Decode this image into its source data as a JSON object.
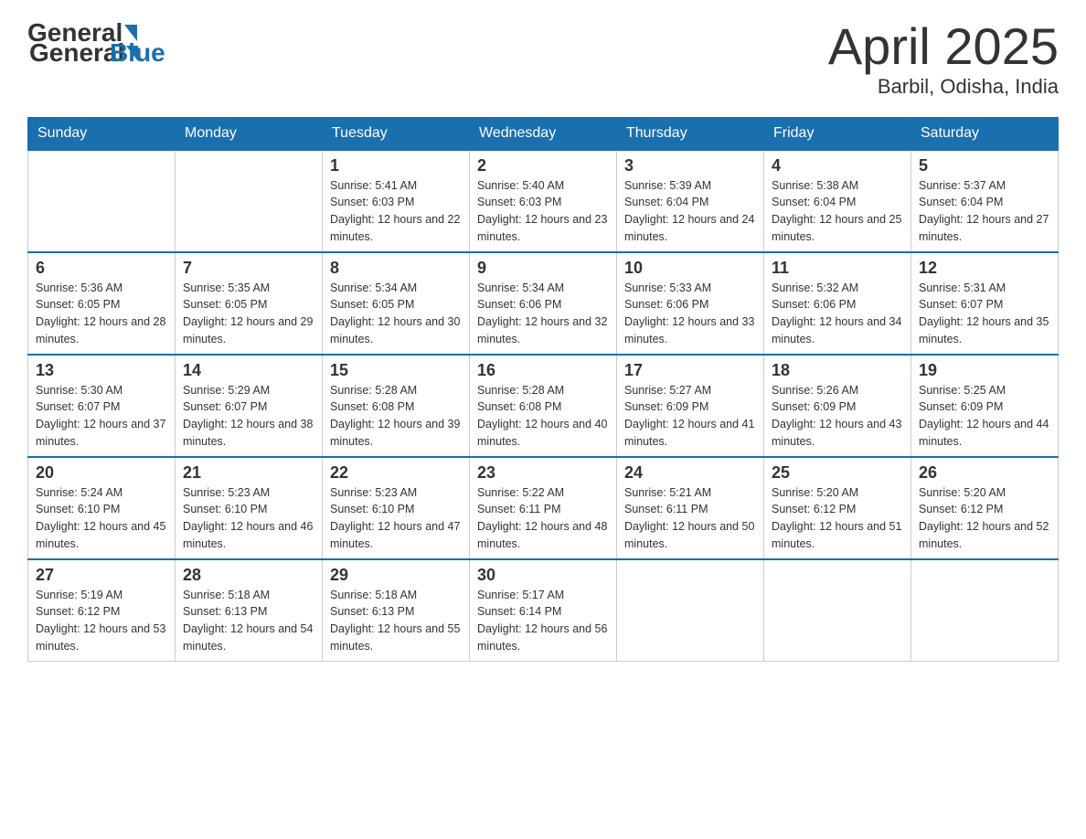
{
  "header": {
    "logo_text_general": "General",
    "logo_text_blue": "Blue",
    "month_title": "April 2025",
    "location": "Barbil, Odisha, India"
  },
  "weekdays": [
    "Sunday",
    "Monday",
    "Tuesday",
    "Wednesday",
    "Thursday",
    "Friday",
    "Saturday"
  ],
  "weeks": [
    [
      {
        "day": "",
        "sunrise": "",
        "sunset": "",
        "daylight": ""
      },
      {
        "day": "",
        "sunrise": "",
        "sunset": "",
        "daylight": ""
      },
      {
        "day": "1",
        "sunrise": "Sunrise: 5:41 AM",
        "sunset": "Sunset: 6:03 PM",
        "daylight": "Daylight: 12 hours and 22 minutes."
      },
      {
        "day": "2",
        "sunrise": "Sunrise: 5:40 AM",
        "sunset": "Sunset: 6:03 PM",
        "daylight": "Daylight: 12 hours and 23 minutes."
      },
      {
        "day": "3",
        "sunrise": "Sunrise: 5:39 AM",
        "sunset": "Sunset: 6:04 PM",
        "daylight": "Daylight: 12 hours and 24 minutes."
      },
      {
        "day": "4",
        "sunrise": "Sunrise: 5:38 AM",
        "sunset": "Sunset: 6:04 PM",
        "daylight": "Daylight: 12 hours and 25 minutes."
      },
      {
        "day": "5",
        "sunrise": "Sunrise: 5:37 AM",
        "sunset": "Sunset: 6:04 PM",
        "daylight": "Daylight: 12 hours and 27 minutes."
      }
    ],
    [
      {
        "day": "6",
        "sunrise": "Sunrise: 5:36 AM",
        "sunset": "Sunset: 6:05 PM",
        "daylight": "Daylight: 12 hours and 28 minutes."
      },
      {
        "day": "7",
        "sunrise": "Sunrise: 5:35 AM",
        "sunset": "Sunset: 6:05 PM",
        "daylight": "Daylight: 12 hours and 29 minutes."
      },
      {
        "day": "8",
        "sunrise": "Sunrise: 5:34 AM",
        "sunset": "Sunset: 6:05 PM",
        "daylight": "Daylight: 12 hours and 30 minutes."
      },
      {
        "day": "9",
        "sunrise": "Sunrise: 5:34 AM",
        "sunset": "Sunset: 6:06 PM",
        "daylight": "Daylight: 12 hours and 32 minutes."
      },
      {
        "day": "10",
        "sunrise": "Sunrise: 5:33 AM",
        "sunset": "Sunset: 6:06 PM",
        "daylight": "Daylight: 12 hours and 33 minutes."
      },
      {
        "day": "11",
        "sunrise": "Sunrise: 5:32 AM",
        "sunset": "Sunset: 6:06 PM",
        "daylight": "Daylight: 12 hours and 34 minutes."
      },
      {
        "day": "12",
        "sunrise": "Sunrise: 5:31 AM",
        "sunset": "Sunset: 6:07 PM",
        "daylight": "Daylight: 12 hours and 35 minutes."
      }
    ],
    [
      {
        "day": "13",
        "sunrise": "Sunrise: 5:30 AM",
        "sunset": "Sunset: 6:07 PM",
        "daylight": "Daylight: 12 hours and 37 minutes."
      },
      {
        "day": "14",
        "sunrise": "Sunrise: 5:29 AM",
        "sunset": "Sunset: 6:07 PM",
        "daylight": "Daylight: 12 hours and 38 minutes."
      },
      {
        "day": "15",
        "sunrise": "Sunrise: 5:28 AM",
        "sunset": "Sunset: 6:08 PM",
        "daylight": "Daylight: 12 hours and 39 minutes."
      },
      {
        "day": "16",
        "sunrise": "Sunrise: 5:28 AM",
        "sunset": "Sunset: 6:08 PM",
        "daylight": "Daylight: 12 hours and 40 minutes."
      },
      {
        "day": "17",
        "sunrise": "Sunrise: 5:27 AM",
        "sunset": "Sunset: 6:09 PM",
        "daylight": "Daylight: 12 hours and 41 minutes."
      },
      {
        "day": "18",
        "sunrise": "Sunrise: 5:26 AM",
        "sunset": "Sunset: 6:09 PM",
        "daylight": "Daylight: 12 hours and 43 minutes."
      },
      {
        "day": "19",
        "sunrise": "Sunrise: 5:25 AM",
        "sunset": "Sunset: 6:09 PM",
        "daylight": "Daylight: 12 hours and 44 minutes."
      }
    ],
    [
      {
        "day": "20",
        "sunrise": "Sunrise: 5:24 AM",
        "sunset": "Sunset: 6:10 PM",
        "daylight": "Daylight: 12 hours and 45 minutes."
      },
      {
        "day": "21",
        "sunrise": "Sunrise: 5:23 AM",
        "sunset": "Sunset: 6:10 PM",
        "daylight": "Daylight: 12 hours and 46 minutes."
      },
      {
        "day": "22",
        "sunrise": "Sunrise: 5:23 AM",
        "sunset": "Sunset: 6:10 PM",
        "daylight": "Daylight: 12 hours and 47 minutes."
      },
      {
        "day": "23",
        "sunrise": "Sunrise: 5:22 AM",
        "sunset": "Sunset: 6:11 PM",
        "daylight": "Daylight: 12 hours and 48 minutes."
      },
      {
        "day": "24",
        "sunrise": "Sunrise: 5:21 AM",
        "sunset": "Sunset: 6:11 PM",
        "daylight": "Daylight: 12 hours and 50 minutes."
      },
      {
        "day": "25",
        "sunrise": "Sunrise: 5:20 AM",
        "sunset": "Sunset: 6:12 PM",
        "daylight": "Daylight: 12 hours and 51 minutes."
      },
      {
        "day": "26",
        "sunrise": "Sunrise: 5:20 AM",
        "sunset": "Sunset: 6:12 PM",
        "daylight": "Daylight: 12 hours and 52 minutes."
      }
    ],
    [
      {
        "day": "27",
        "sunrise": "Sunrise: 5:19 AM",
        "sunset": "Sunset: 6:12 PM",
        "daylight": "Daylight: 12 hours and 53 minutes."
      },
      {
        "day": "28",
        "sunrise": "Sunrise: 5:18 AM",
        "sunset": "Sunset: 6:13 PM",
        "daylight": "Daylight: 12 hours and 54 minutes."
      },
      {
        "day": "29",
        "sunrise": "Sunrise: 5:18 AM",
        "sunset": "Sunset: 6:13 PM",
        "daylight": "Daylight: 12 hours and 55 minutes."
      },
      {
        "day": "30",
        "sunrise": "Sunrise: 5:17 AM",
        "sunset": "Sunset: 6:14 PM",
        "daylight": "Daylight: 12 hours and 56 minutes."
      },
      {
        "day": "",
        "sunrise": "",
        "sunset": "",
        "daylight": ""
      },
      {
        "day": "",
        "sunrise": "",
        "sunset": "",
        "daylight": ""
      },
      {
        "day": "",
        "sunrise": "",
        "sunset": "",
        "daylight": ""
      }
    ]
  ]
}
